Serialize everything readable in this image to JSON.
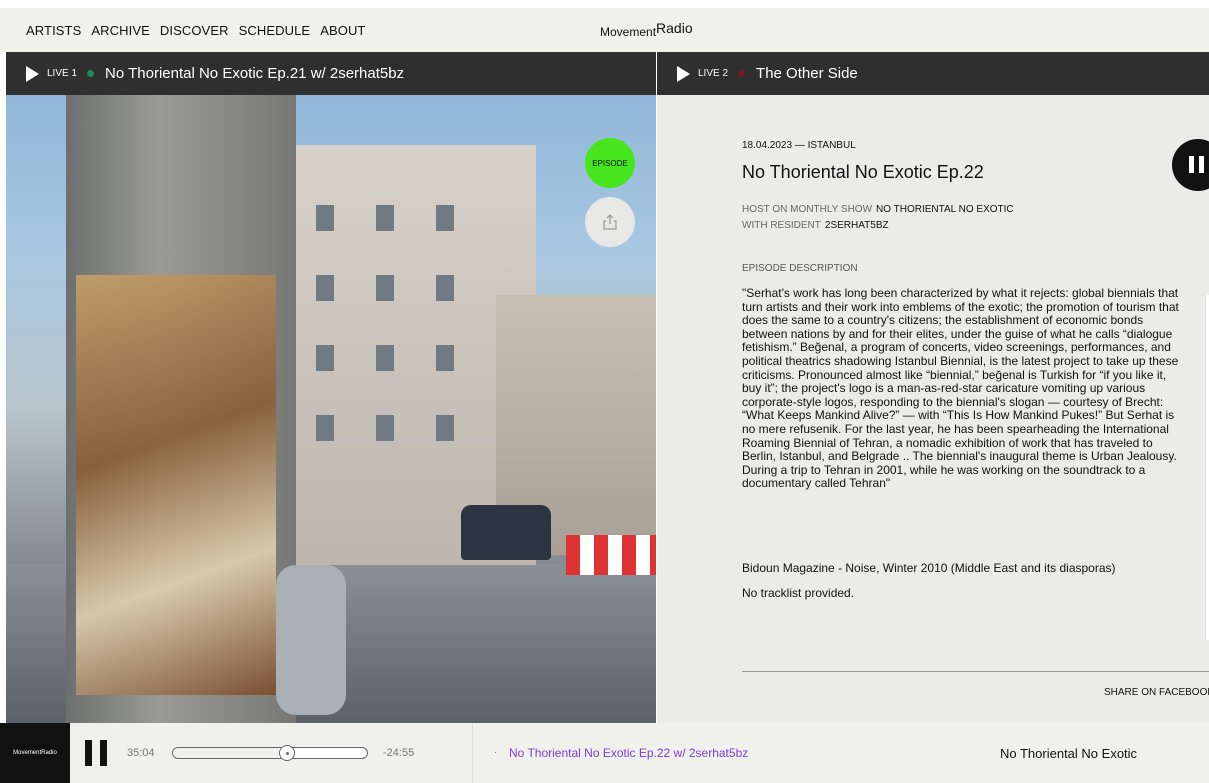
{
  "nav": {
    "links": [
      "ARTISTS",
      "ARCHIVE",
      "DISCOVER",
      "SCHEDULE",
      "ABOUT"
    ],
    "logo_small": "Movement",
    "logo_big": "Radio"
  },
  "live1": {
    "label": "LIVE 1",
    "title": "No Thoriental No Exotic Ep.21 w/ 2serhat5bz"
  },
  "live2": {
    "label": "LIVE 2",
    "title": "The Other Side"
  },
  "photo": {
    "episode_button": "EPISODE"
  },
  "episode": {
    "date_location": "18.04.2023 — ISTANBUL",
    "title": "No Thoriental No Exotic Ep.22",
    "host_label": "HOST ON MONTHLY SHOW",
    "host_value": "NO THORIENTAL NO EXOTIC",
    "resident_label": "WITH RESIDENT",
    "resident_value": "2SERHAT5BZ",
    "description_heading": "EPISODE DESCRIPTION",
    "description": "\"Serhat's work has long been characterized by what it  rejects: global biennials that turn artists and their work  into emblems of the exotic; the promotion of tourism that  does the same to a country's citizens; the establishment  of economic bonds between nations by and for their elites, under the guise of what he calls “dialogue fetishism.” Beğenal, a program of concerts, video screenings, performances, and political theatrics shadowing Istanbul Biennial, is the latest project to take up these criticisms. Pronounced almost like “biennial,”  beğenal is Turkish for “if you like it, buy it”; the project's  logo is a man-as-red-star caricature vomiting up various corporate-style logos, responding to the biennial's slogan — courtesy of Brecht: “What Keeps Mankind Alive?” — with “This Is How Mankind Pukes!” But Serhat  is no mere refusenik. For the last year, he has been spearheading the International Roaming Biennial of Tehran, a nomadic exhibition of work that has traveled to Berlin, Istanbul, and Belgrade .. The biennial's inaugural theme is Urban Jealousy. During a trip to Tehran in 2001, while he was working on the soundtrack to a documentary called Tehran\"",
    "source": "Bidoun Magazine - Noise, Winter 2010 (Middle East and its diasporas)",
    "tracklist": "No tracklist provided.",
    "share_label": "SHARE ON FACEBOOK"
  },
  "player": {
    "logo_small": "Movement",
    "logo_big": "Radio",
    "elapsed": "35:04",
    "remaining": "-24:55",
    "progress": 0.59,
    "bullet": "·",
    "track_title": "No Thoriental No Exotic Ep.22 w/ 2serhat5bz",
    "show_title": "No Thoriental No Exotic"
  },
  "colors": {
    "episode_green": "#47e51c",
    "live_bar": "#2f2f30",
    "panel_bg": "#ebebe8",
    "track_purple": "#7b3fd6"
  }
}
